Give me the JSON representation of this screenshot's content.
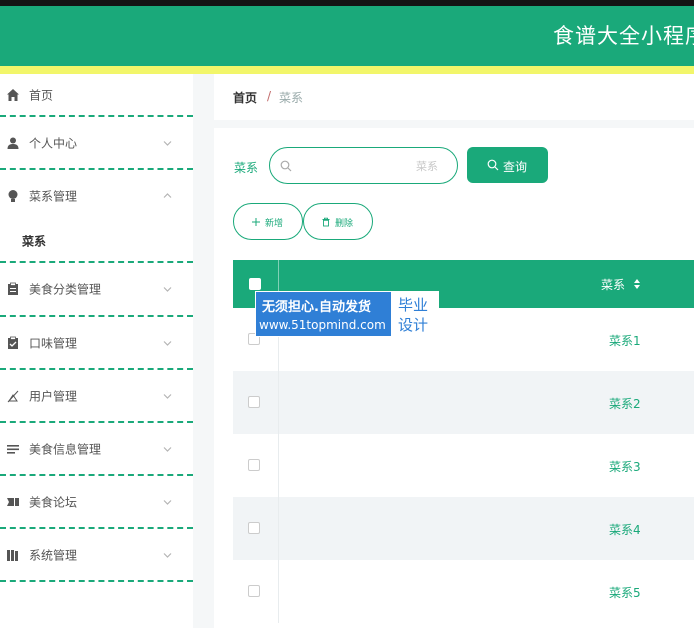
{
  "header": {
    "title": "食谱大全小程序"
  },
  "sidebar": {
    "items": [
      {
        "label": "首页",
        "icon": "home-icon",
        "expandable": false
      },
      {
        "label": "个人中心",
        "icon": "user-icon",
        "expandable": true
      },
      {
        "label": "菜系管理",
        "icon": "bulb-icon",
        "expandable": true,
        "expanded": true
      },
      {
        "label": "美食分类管理",
        "icon": "clipboard-icon",
        "expandable": true
      },
      {
        "label": "口味管理",
        "icon": "checklist-icon",
        "expandable": true
      },
      {
        "label": "用户管理",
        "icon": "users-icon",
        "expandable": true
      },
      {
        "label": "美食信息管理",
        "icon": "list-icon",
        "expandable": true
      },
      {
        "label": "美食论坛",
        "icon": "ticket-icon",
        "expandable": true
      },
      {
        "label": "系统管理",
        "icon": "book-icon",
        "expandable": true
      }
    ],
    "submenu": {
      "label": "菜系"
    }
  },
  "breadcrumb": {
    "home": "首页",
    "separator": "/",
    "current": "菜系"
  },
  "search": {
    "label": "菜系",
    "placeholder": "菜系",
    "value": "",
    "button_label": "查询"
  },
  "actions": {
    "add_label": "新增",
    "delete_label": "删除"
  },
  "table": {
    "column_header": "菜系",
    "rows": [
      "菜系1",
      "菜系2",
      "菜系3",
      "菜系4",
      "菜系5"
    ]
  },
  "watermark": {
    "line1": "无须担心.自动发货",
    "line2": "www.51topmind.com",
    "right1": "毕业",
    "right2": "设计"
  },
  "colors": {
    "primary": "#1aa97a",
    "stripe": "#f2f66a",
    "watermark": "#2f7fd6"
  }
}
